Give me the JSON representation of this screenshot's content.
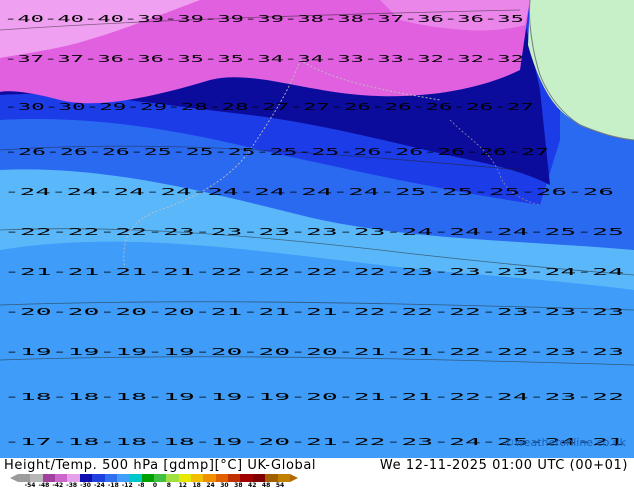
{
  "title": "Height/Temp. 500 hPa [gdmp][°C] UK-Global",
  "datetime": "We 12-11-2025 01:00 UTC (00+01)",
  "credit": "©weatheronline.co.uk",
  "colorbar": {
    "ticks": [
      "-54",
      "-48",
      "-42",
      "-38",
      "-30",
      "-24",
      "-18",
      "-12",
      "-8",
      "0",
      "8",
      "12",
      "18",
      "24",
      "30",
      "38",
      "42",
      "48",
      "54"
    ],
    "colors": [
      "#9c9c9c",
      "#b8b8b8",
      "#a040a0",
      "#cc66cc",
      "#e8a0e8",
      "#1010b0",
      "#2040e0",
      "#3070f0",
      "#40a0f8",
      "#00c8c8",
      "#00a000",
      "#40c040",
      "#a0e040",
      "#e8e800",
      "#f0c000",
      "#f09000",
      "#e06000",
      "#c03000",
      "#a00000",
      "#800000",
      "#a06000",
      "#c08000"
    ]
  },
  "map_colors": {
    "magenta": "#e060e0",
    "pink": "#f0a0f0",
    "navy": "#0c0c9c",
    "blue": "#1c3ce8",
    "mid_blue": "#2a6af0",
    "light_blue": "#3f9cf8",
    "sky": "#5ab8fa",
    "land": "#c8f0c8"
  },
  "contour_labels": {
    "row1": "-40-40-40-39-39-39-39-38-38-37-36-36-35",
    "row2": "-37-37-36-36-35-35-34-34-33-33-32-32-32",
    "row3": "-30-30-29-29-28-28-27-27-26-26-26-26-27",
    "row4": "-26-26-26-25-25-25-25-25-26-26-26-26-27",
    "row5": "-24-24-24-24-24-24-24-24-25-25-25-26-26",
    "row6": "-22-22-22-23-23-23-23-23-24-24-24-25-25",
    "row7": "-21-21-21-21-22-22-22-22-23-23-23-24-24",
    "row8": "-20-20-20-20-21-21-21-22-22-22-23-23-23",
    "row9": "-19-19-19-19-20-20-20-21-21-22-22-23-23",
    "row10": "-18-18-18-19-19-19-20-21-21-22-24-23-22",
    "row11": "-17-18-18-18-19-20-21-22-23-24-25-24-21"
  }
}
